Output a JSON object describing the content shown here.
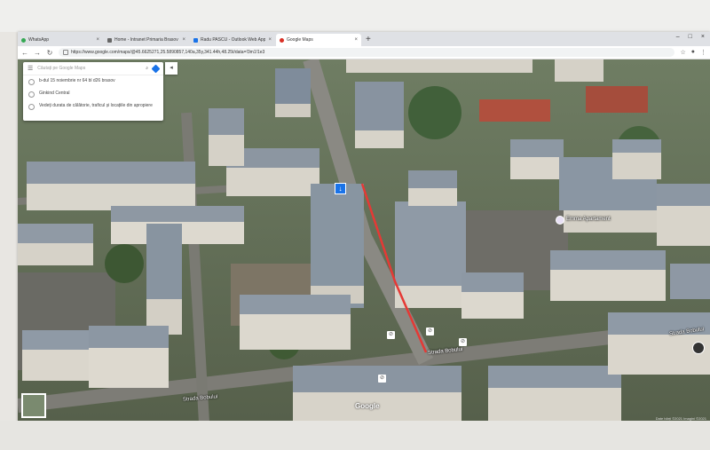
{
  "tabs": [
    {
      "title": "WhatsApp",
      "fav": "whatsapp-icon",
      "active": false
    },
    {
      "title": "Home - Intranet Primaria Brasov",
      "fav": "page-icon",
      "active": false
    },
    {
      "title": "Radu PASCU - Outlook Web App",
      "fav": "outlook-icon",
      "active": false
    },
    {
      "title": "Google Maps",
      "fav": "maps-icon",
      "active": true
    }
  ],
  "omnibox": {
    "url": "https://www.google.com/maps/@45.6625271,25.5890857,140a,35y,341.44h,48.25t/data=!3m1!1e3"
  },
  "window_controls": {
    "minimize": "–",
    "maximize": "□",
    "close": "×"
  },
  "search": {
    "placeholder": "Căutați pe Google Maps",
    "suggestions": [
      "b-dul 15 noiembrie nr 64 bl d26 brasov",
      "Ginkind Central",
      "Vedeți durata de călătorie, traficul și locațiile din apropiere"
    ]
  },
  "map": {
    "labels": {
      "emma": "Emma Apartament",
      "street1": "Strada Bobului",
      "street2": "Strada Bobului",
      "street3": "Strada Bobului"
    },
    "google_logo": "Google",
    "attribution": "Date hărți ©2021 Imagini ©2021"
  }
}
